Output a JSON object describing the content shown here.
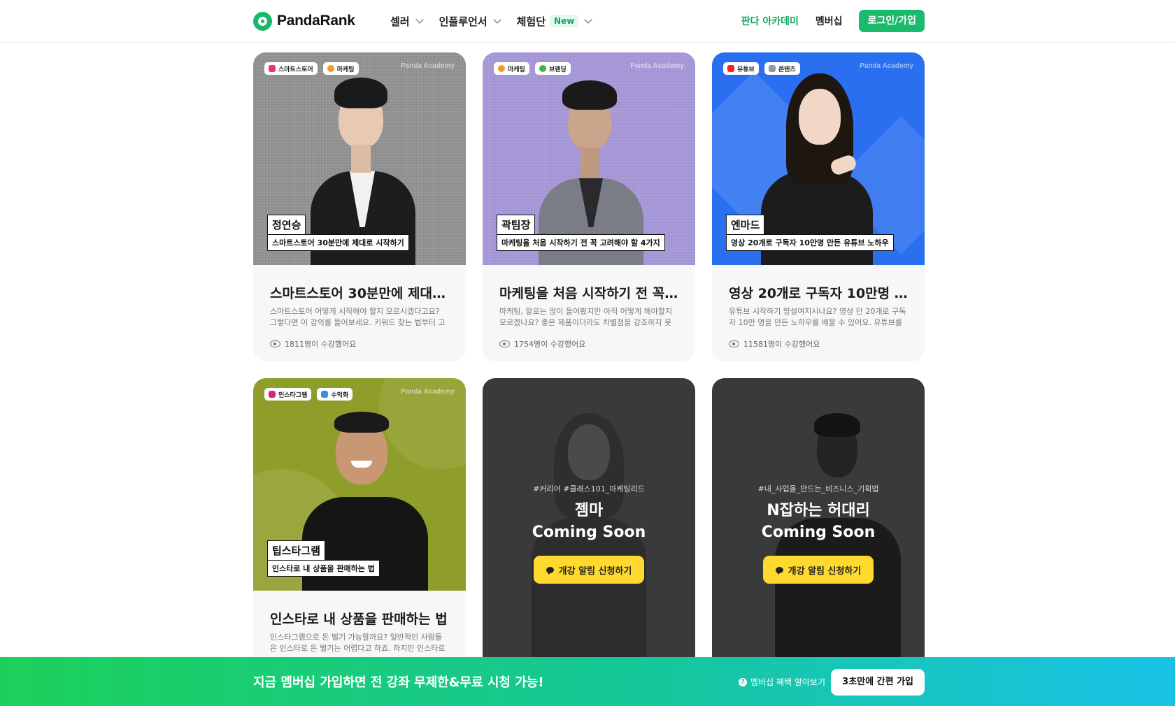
{
  "header": {
    "logo_text": "PandaRank",
    "nav": [
      {
        "label": "셀러",
        "badge": ""
      },
      {
        "label": "인플루언서",
        "badge": ""
      },
      {
        "label": "체험단",
        "badge": "New"
      }
    ],
    "academy_label": "판다 아카데미",
    "membership_label": "멤버십",
    "login_label": "로그인/가입"
  },
  "watermark": "Panda Academy",
  "courses": [
    {
      "tags": [
        "스마트스토어",
        "마케팅"
      ],
      "instructor": "정연승",
      "subtitle": "스마트스토어 30분만에 제대로 시작하기",
      "title": "스마트스토어 30분만에 제대로 시작하기",
      "description": "스마트스토어 어떻게 시작해야 할지 모르시겠다고요? 그렇다면 이 강의를 들어보세요. 키워드 찾는 법부터 고객 관리까지",
      "students": "1811명이 수강했어요"
    },
    {
      "tags": [
        "마케팅",
        "브랜딩"
      ],
      "instructor": "곽팀장",
      "subtitle": "마케팅을 처음 시작하기 전 꼭 고려해야 할 4가지",
      "title": "마케팅을 처음 시작하기 전 꼭 고려해야 할 4가지",
      "description": "마케팅, 말로는 많이 들어봤지만 아직 어떻게 해야할지 모르겠나요? 좋은 제품이더라도 차별점을 강조하지 못하면",
      "students": "1754명이 수강했어요"
    },
    {
      "tags": [
        "유튜브",
        "콘텐츠"
      ],
      "instructor": "엔마드",
      "subtitle": "영상 20개로 구독자 10만명 만든 유튜브 노하우",
      "title": "영상 20개로 구독자 10만명 만든 유튜브 노하우",
      "description": "유튜브 시작하기 망설여지시나요? 영상 단 20개로 구독자 10만 명을 만든 노하우를 배울 수 있어요. 유튜브를 시작하고",
      "students": "11581명이 수강했어요"
    },
    {
      "tags": [
        "인스타그램",
        "수익화"
      ],
      "instructor": "팁스타그램",
      "subtitle": "인스타로 내 상품을 판매하는 법",
      "title": "인스타로 내 상품을 판매하는 법",
      "description": "인스타그램으로 돈 벌기 가능할까요? 일반적인 사람들은 인스타로 돈  벌기는 어렵다고 하죠. 하지만 인스타로 충분히",
      "students": ""
    }
  ],
  "coming_soon": [
    {
      "tags": "#커리어  #클래스101_마케팅리드",
      "name": "젬마",
      "status": "Coming Soon",
      "button": "개강 알림 신청하기"
    },
    {
      "tags": "#내_사업을_만드는_비즈니스_기획법",
      "name": "N잡하는 허대리",
      "status": "Coming Soon",
      "button": "개강 알림 신청하기"
    }
  ],
  "banner": {
    "text": "지금 멤버십 가입하면 전 강좌 무제한&무료 시청 가능!",
    "info": "멤버십 혜택 알아보기",
    "button": "3초만에 간편 가입"
  },
  "colors": {
    "brand": "#1cba6d",
    "card1_bg": "#8e8e8e",
    "card2_bg": "#a394d6",
    "card3_bg": "#2a6ff0",
    "card4_bg": "#8f9e2a",
    "soon_bg": "#3a3a3a",
    "alert_button": "#ffd92e"
  }
}
